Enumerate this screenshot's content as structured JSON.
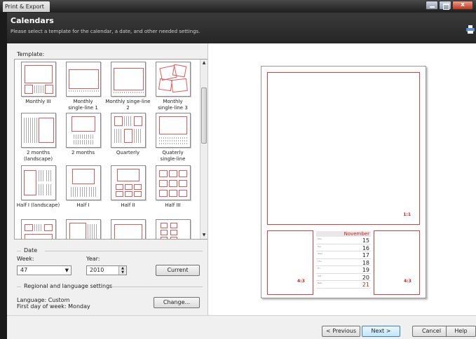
{
  "window": {
    "title": "Print & Export",
    "close_label": "x"
  },
  "header": {
    "title": "Calendars",
    "subtitle": "Please select a template for the calendar, a date, and other needed settings."
  },
  "templates": {
    "label": "Template:",
    "items": [
      {
        "l1": "Monthly III",
        "l2": ""
      },
      {
        "l1": "Monthly",
        "l2": "single-line 1"
      },
      {
        "l1": "Monthly singe-line",
        "l2": "2"
      },
      {
        "l1": "Monthly",
        "l2": "single-line 3"
      },
      {
        "l1": "2 months",
        "l2": "(landscape)"
      },
      {
        "l1": "2 months",
        "l2": ""
      },
      {
        "l1": "Quarterly",
        "l2": ""
      },
      {
        "l1": "Quaterly",
        "l2": "single-line"
      },
      {
        "l1": "Half I (landscape)",
        "l2": ""
      },
      {
        "l1": "Half I",
        "l2": ""
      },
      {
        "l1": "Half II",
        "l2": ""
      },
      {
        "l1": "Half III",
        "l2": ""
      }
    ]
  },
  "date": {
    "section_label": "Date",
    "week_label": "Week:",
    "week_value": "47",
    "year_label": "Year:",
    "year_value": "2010",
    "current_button": "Current"
  },
  "regional": {
    "section_label": "Regional and language settings",
    "language": "Language: Custom",
    "first_day": "First day of week: Monday",
    "change_button": "Change..."
  },
  "preview": {
    "ratio_main": "1:1",
    "ratio_left": "4:3",
    "ratio_right": "4:3",
    "month": "November",
    "days": [
      {
        "n": "Mon",
        "d": "15"
      },
      {
        "n": "Tue",
        "d": "16"
      },
      {
        "n": "Wed",
        "d": "17"
      },
      {
        "n": "Thu",
        "d": "18"
      },
      {
        "n": "Fri",
        "d": "19"
      },
      {
        "n": "Sat",
        "d": "20"
      },
      {
        "n": "Sun",
        "d": "21"
      }
    ]
  },
  "footer": {
    "prev": "< Previous",
    "next": "Next >",
    "cancel": "Cancel",
    "help": "Help"
  },
  "colors": {
    "accent_red": "#e23b3b",
    "header_bg": "#2e2e2e"
  }
}
